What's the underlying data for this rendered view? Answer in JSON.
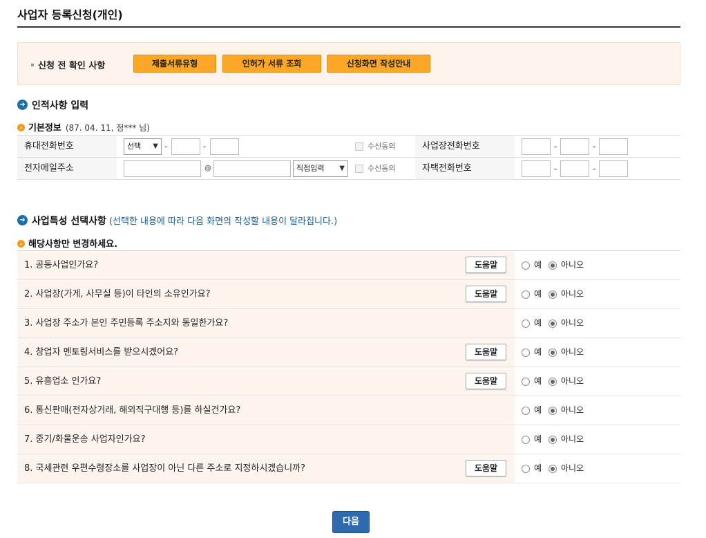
{
  "page": {
    "title": "사업자 등록신청(개인)"
  },
  "confirm": {
    "label": "신청 전 확인 사항",
    "buttons": [
      "제출서류유형",
      "인허가 서류 조회",
      "신청화면 작성안내"
    ]
  },
  "identity": {
    "heading": "인적사항 입력",
    "basic_label": "기본정보",
    "basic_note": "(87. 04. 11, 정*** 님)",
    "rows": {
      "mobile": {
        "label": "휴대전화번호",
        "select": "선택",
        "consent": "수신동의"
      },
      "email": {
        "label": "전자메일주소",
        "at": "@",
        "domain_select": "직접입력",
        "consent": "수신동의"
      },
      "biz_phone": {
        "label": "사업장전화번호"
      },
      "home_phone": {
        "label": "자택전화번호"
      }
    },
    "dash": "-"
  },
  "business": {
    "heading": "사업특성 선택사항",
    "heading_note": "(선택한 내용에 따라 다음 화면의 작성할 내용이 달라집니다.)",
    "sub_label": "해당사항만 변경하세요.",
    "help_label": "도움말",
    "yes_label": "예",
    "no_label": "아니오",
    "questions": [
      {
        "text": "1. 공동사업인가요?",
        "has_help": true,
        "selected": "no"
      },
      {
        "text": "2. 사업장(가게, 사무실 등)이 타인의 소유인가요?",
        "has_help": true,
        "selected": "no"
      },
      {
        "text": "3. 사업장 주소가 본인 주민등록 주소지와 동일한가요?",
        "has_help": false,
        "selected": "no"
      },
      {
        "text": "4. 창업자 멘토링서비스를 받으시겠어요?",
        "has_help": true,
        "selected": "no"
      },
      {
        "text": "5. 유흥업소 인가요?",
        "has_help": true,
        "selected": "no"
      },
      {
        "text": "6. 통신판매(전자상거래, 해외직구대행 등)를 하실건가요?",
        "has_help": false,
        "selected": "no"
      },
      {
        "text": "7. 중기/화물운송 사업자인가요?",
        "has_help": false,
        "selected": "no"
      },
      {
        "text": "8. 국세관련 우편수령장소를 사업장이 아닌 다른 주소로 지정하시겠습니까?",
        "has_help": true,
        "selected": "no"
      }
    ]
  },
  "next_button": "다음"
}
